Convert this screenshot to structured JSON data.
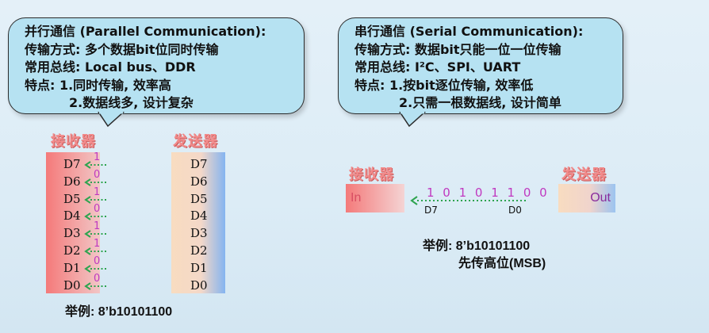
{
  "parallel": {
    "lines": [
      "并行通信 (Parallel Communication):",
      "传输方式: 多个数据bit位同时传输",
      "常用总线: Local bus、DDR",
      "特点: 1.同时传输, 效率高",
      "2.数据线多, 设计复杂"
    ],
    "receiver_label": "接收器",
    "sender_label": "发送器",
    "pins": [
      "D7",
      "D6",
      "D5",
      "D4",
      "D3",
      "D2",
      "D1",
      "D0"
    ],
    "bits": [
      "1",
      "0",
      "1",
      "0",
      "1",
      "1",
      "0",
      "0"
    ],
    "example": "举例: 8’b10101100"
  },
  "serial": {
    "lines": [
      "串行通信 (Serial Communication):",
      "传输方式: 数据bit只能一位一位传输",
      "常用总线: I²C、SPI、UART",
      "特点: 1.按bit逐位传输, 效率低",
      "2.只需一根数据线, 设计简单"
    ],
    "receiver_label": "接收器",
    "sender_label": "发送器",
    "in_label": "In",
    "out_label": "Out",
    "bit_stream": "10101100",
    "msb_label": "D7",
    "lsb_label": "D0",
    "example": "举例: 8’b10101100",
    "msb_note": "先传高位(MSB)"
  },
  "colors": {
    "bubble_fill": "#b6e2f2",
    "header_red": "#f28b8b",
    "arrow_green": "#2ea44f",
    "bit_magenta": "#c039c0"
  }
}
